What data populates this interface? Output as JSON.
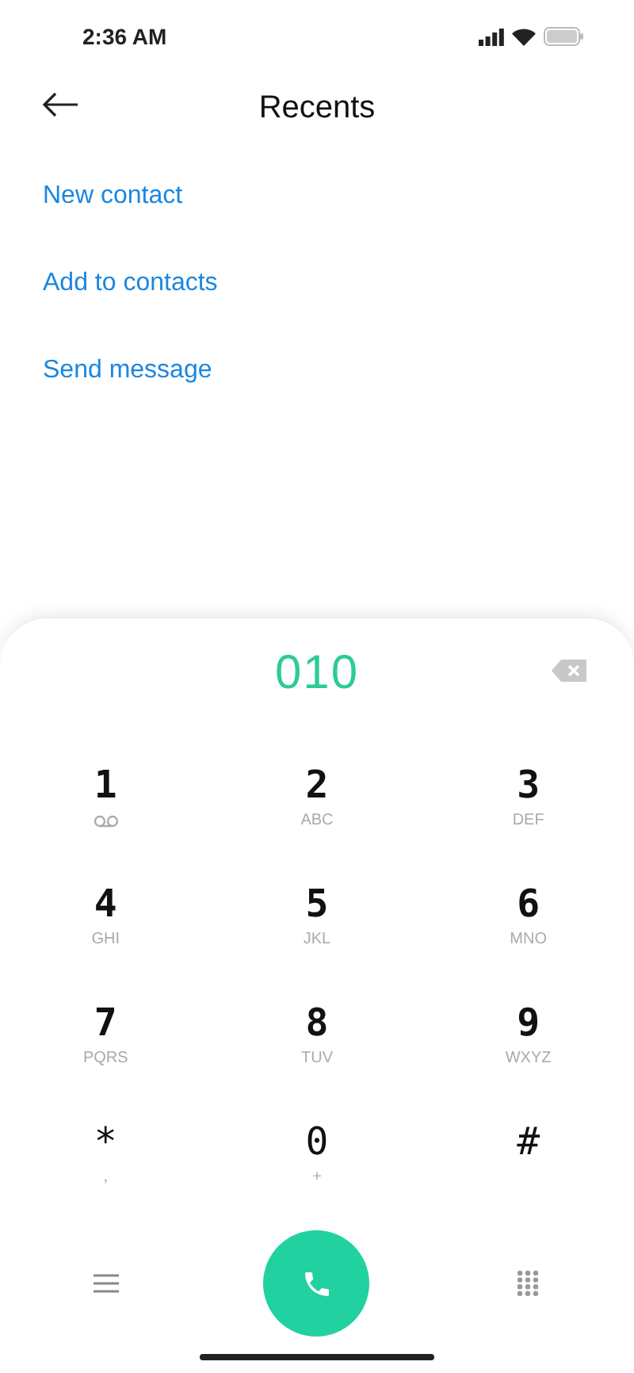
{
  "status_bar": {
    "time": "2:36 AM"
  },
  "header": {
    "title": "Recents"
  },
  "actions": [
    "New contact",
    "Add to contacts",
    "Send message"
  ],
  "dialer": {
    "number": "010",
    "keys": [
      {
        "digit": "1",
        "kind": "voicemail"
      },
      {
        "digit": "2",
        "kind": "letters",
        "sub": "ABC"
      },
      {
        "digit": "3",
        "kind": "letters",
        "sub": "DEF"
      },
      {
        "digit": "4",
        "kind": "letters",
        "sub": "GHI"
      },
      {
        "digit": "5",
        "kind": "letters",
        "sub": "JKL"
      },
      {
        "digit": "6",
        "kind": "letters",
        "sub": "MNO"
      },
      {
        "digit": "7",
        "kind": "letters",
        "sub": "PQRS"
      },
      {
        "digit": "8",
        "kind": "letters",
        "sub": "TUV"
      },
      {
        "digit": "9",
        "kind": "letters",
        "sub": "WXYZ"
      },
      {
        "digit": "*",
        "kind": "symbol",
        "sub": ","
      },
      {
        "digit": "0",
        "kind": "symbol",
        "sub": "+"
      },
      {
        "digit": "#",
        "kind": "symbol"
      }
    ]
  }
}
